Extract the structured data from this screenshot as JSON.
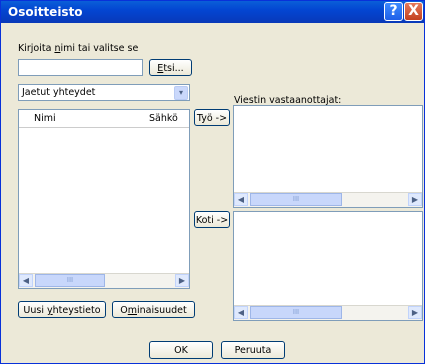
{
  "dialog": {
    "title": "Osoitteisto",
    "help_glyph": "?",
    "close_glyph": "X"
  },
  "search": {
    "label_pre": "Kirjoita ",
    "label_key": "n",
    "label_post": "imi tai valitse se",
    "input_value": "",
    "find_key": "E",
    "find_rest": "tsi..."
  },
  "source": {
    "selected": "Jaetut yhteydet",
    "arrow": "▾"
  },
  "contacts": {
    "columns": [
      "Nimi",
      "Sähkö"
    ]
  },
  "recipients": {
    "label": "Viestin vastaanottajat:",
    "work_button": "Työ ->",
    "home_button": "Koti ->"
  },
  "actions": {
    "new_contact_pre": "Uusi ",
    "new_contact_key": "y",
    "new_contact_post": "hteystieto",
    "properties_pre": "O",
    "properties_key": "m",
    "properties_post": "inaisuudet",
    "ok": "OK",
    "cancel": "Peruuta"
  },
  "scroll": {
    "left": "◀",
    "right": "▶",
    "grip": "III"
  }
}
